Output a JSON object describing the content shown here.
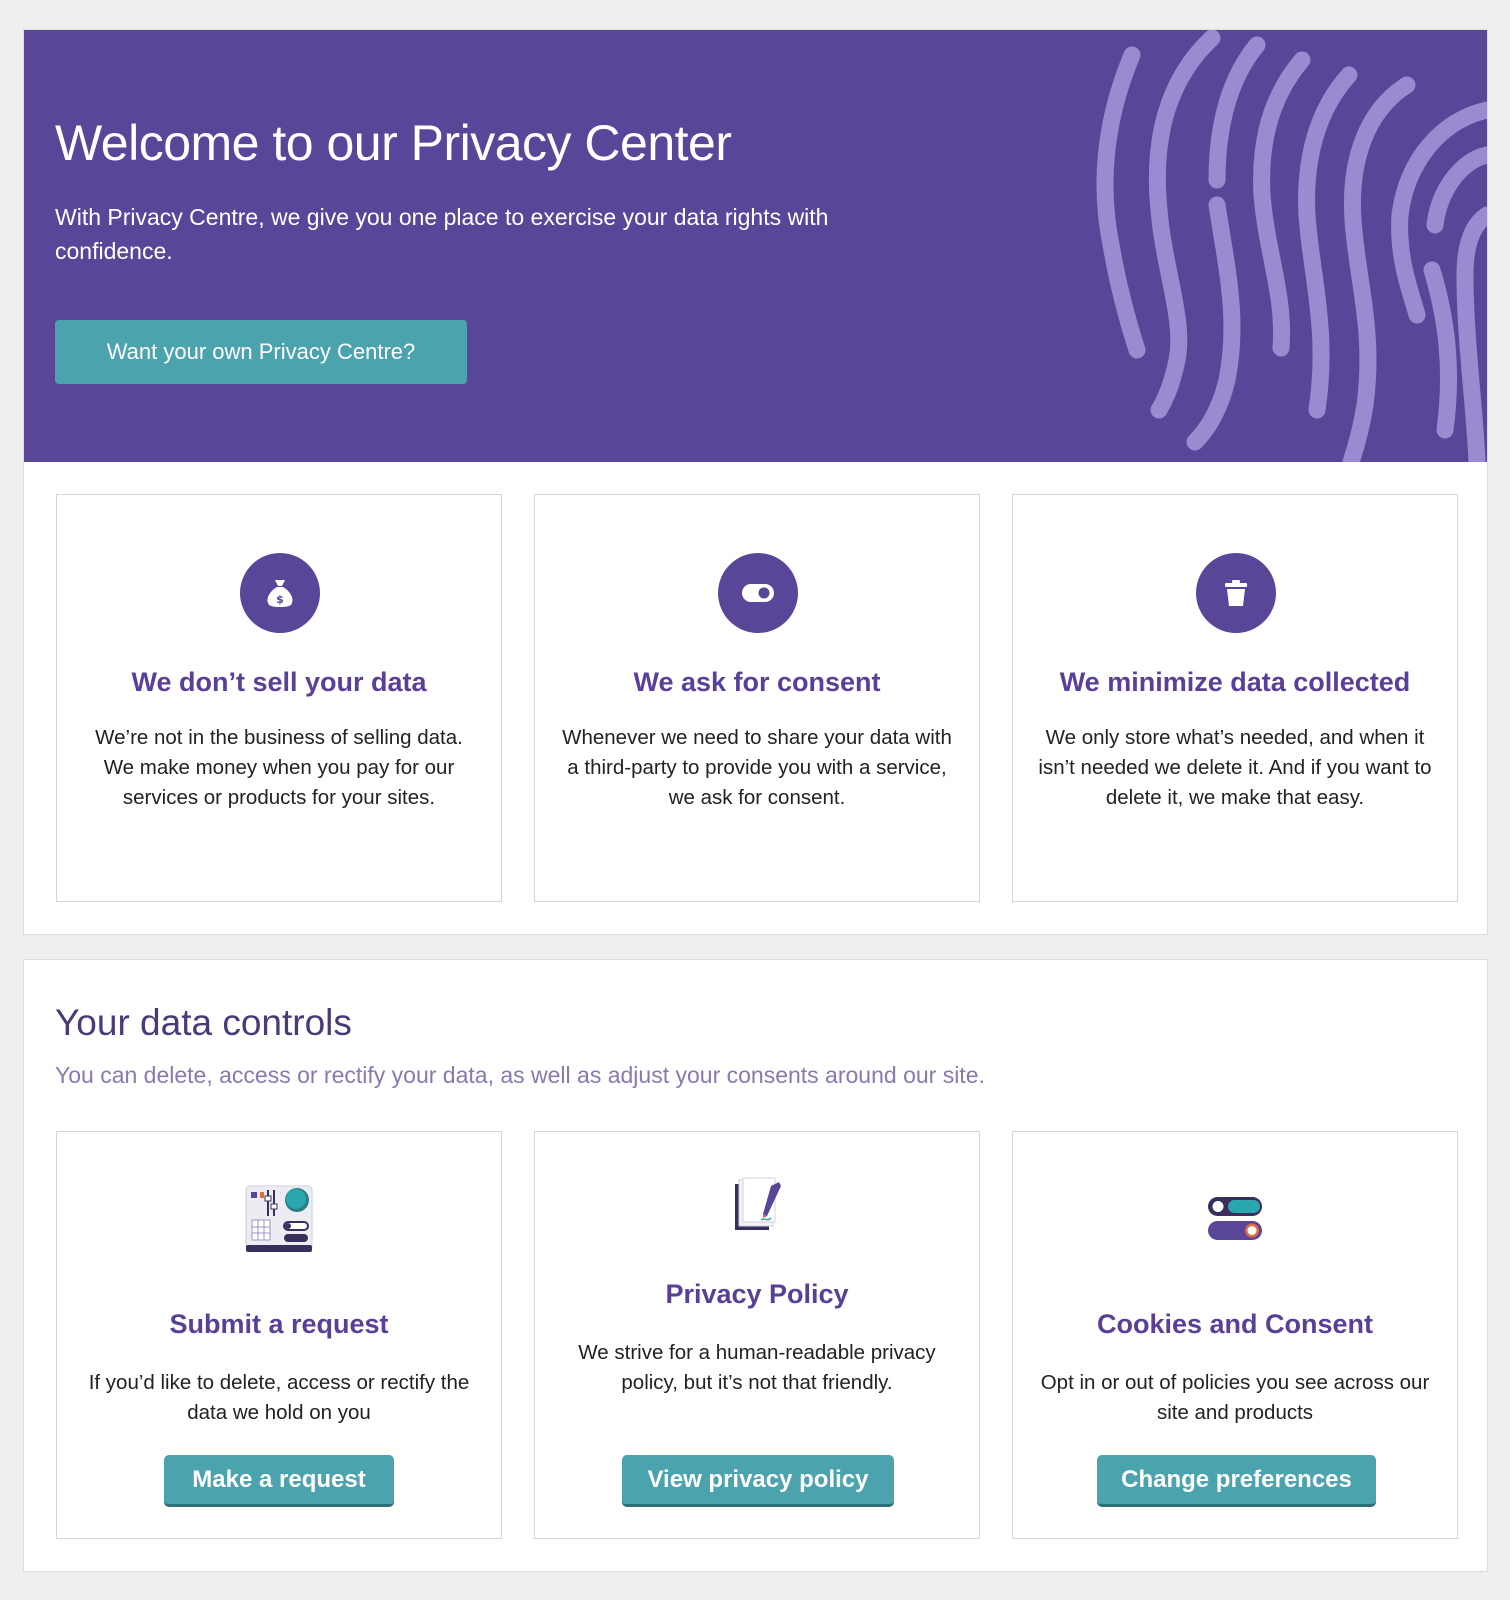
{
  "hero": {
    "title": "Welcome to our Privacy Center",
    "subtitle": "With Privacy Centre, we give you one place to exercise your data rights with confidence.",
    "cta_label": "Want your own Privacy Centre?",
    "decoration": "fingerprint-icon"
  },
  "values": [
    {
      "icon": "money-bag-icon",
      "title": "We don’t sell your data",
      "text": "We’re not in the business of selling data. We make money when you pay for our services or products for your sites."
    },
    {
      "icon": "toggle-icon",
      "title": "We ask for consent",
      "text": "Whenever we need to share your data with a third-party to provide you with a service, we ask for consent."
    },
    {
      "icon": "trash-icon",
      "title": "We minimize data collected",
      "text": "We only store what’s needed, and when it isn’t needed we delete it. And if you want to delete it, we make that easy."
    }
  ],
  "controls": {
    "title": "Your data controls",
    "subtitle": "You can delete, access or rectify your data, as well as adjust your consents around our site.",
    "cards": [
      {
        "icon": "request-form-icon",
        "title": "Submit a request",
        "text": "If you’d like to delete, access or rectify the data we hold on you",
        "button": "Make a request"
      },
      {
        "icon": "policy-document-icon",
        "title": "Privacy Policy",
        "text": "We strive for a human-readable privacy policy, but it’s not that friendly.",
        "button": "View privacy policy"
      },
      {
        "icon": "toggles-icon",
        "title": "Cookies and Consent",
        "text": "Opt in or out of policies you see across our site and products",
        "button": "Change preferences"
      }
    ]
  },
  "colors": {
    "brand_purple": "#5a4699",
    "accent_teal": "#4ba3ad",
    "heading_purple": "#5a3f99",
    "subtitle_lilac": "#8a78b0"
  }
}
